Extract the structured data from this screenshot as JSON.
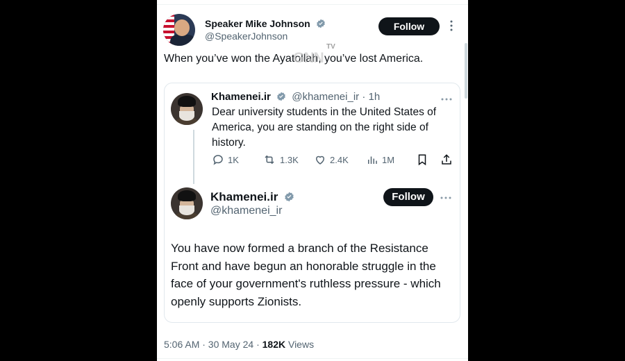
{
  "tweet": {
    "author_name": "Speaker Mike Johnson",
    "author_handle": "@SpeakerJohnson",
    "follow_label": "Follow",
    "text": "When you’ve won the Ayatollah, you’ve lost America.",
    "watermark": "GNN",
    "watermark_sub": "TV",
    "time": "5:06 AM · 30 May 24 · ",
    "views_count": "182K",
    "views_label": " Views"
  },
  "quoted": {
    "first": {
      "author_name": "Khamenei.ir",
      "author_handle": "@khamenei_ir",
      "age": "· 1h",
      "text": "Dear university students in the United States of America, you are standing on the right side of history.",
      "replies": "1K",
      "reposts": "1.3K",
      "likes": "2.4K",
      "views": "1M"
    },
    "second": {
      "author_name": "Khamenei.ir",
      "author_handle": "@khamenei_ir",
      "follow_label": "Follow",
      "text": "You have now formed a branch of the Resistance Front and have begun an honorable struggle in the face of your government's ruthless pressure - which openly supports Zionists."
    }
  },
  "icons": {
    "verified": "verified-badge-icon",
    "more": "more-options-icon",
    "reply": "reply-icon",
    "repost": "repost-icon",
    "like": "like-icon",
    "views": "views-icon",
    "bookmark": "bookmark-icon",
    "share": "share-icon"
  },
  "colors": {
    "text": "#0f1419",
    "muted": "#536471",
    "verified": "#829aab",
    "button": "#0f1419"
  }
}
